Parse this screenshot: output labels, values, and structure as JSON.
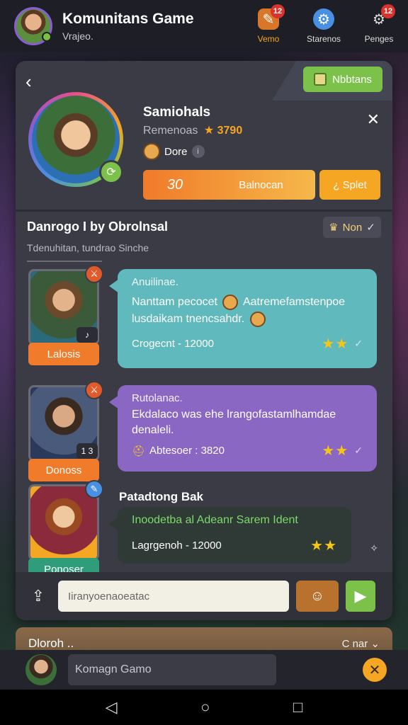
{
  "header": {
    "title": "Komunitans Game",
    "subtitle": "Vrajeo.",
    "nav": [
      {
        "label": "Vemo",
        "badge": "12",
        "icon": "feather-icon"
      },
      {
        "label": "Starenos",
        "badge": "",
        "icon": "gear-cloud-icon"
      },
      {
        "label": "Penges",
        "badge": "12",
        "icon": "settings-icon"
      }
    ]
  },
  "profile": {
    "tag_label": "Nbbtans",
    "name": "Samiohals",
    "subtitle": "Remenoas",
    "score": "★ 3790",
    "role": "Dore",
    "action_number": "30",
    "action_label": "Balnocan",
    "split_label": "¿ Splet"
  },
  "section": {
    "title": "Danrogo I by Obrolnsal",
    "subtitle": "Tdenuhitan, tundrao Sinche",
    "filter_label": "Non"
  },
  "messages": [
    {
      "author_label": "Lalosis",
      "header": "Anuilinae.",
      "text_a": "Nanttam pecocet",
      "text_b": "Aatremefamstenpoe",
      "text_c": "lusdaikam tnencsahdr.",
      "meta": "Crogecnt - 12000",
      "stars": "★★",
      "bubble_color": "#5fb9bd",
      "label_color": "#f07b2a",
      "badge_color": "#e05a2b"
    },
    {
      "author_label": "Donoss",
      "header": "Rutolanac.",
      "text": "Ekdalaco was ehe lrangofastamlhamdae denaleli.",
      "meta": "Abtesoer : 3820",
      "mini": "1 3",
      "stars": "★★",
      "bubble_color": "#8b67c4",
      "label_color": "#f07b2a",
      "badge_color": "#e05a2b"
    },
    {
      "author_label": "Ponoser",
      "header": "Patadtong Bak",
      "text": "Inoodetba al Adeanr Sarem Ident",
      "meta": "Lagrgenoh - 12000",
      "stars": "★★",
      "bubble_color": "#2f3a36",
      "label_color": "#2f9c7a",
      "badge_color": "#4a90e2"
    }
  ],
  "input": {
    "placeholder": "Iiranyoenaoeatac"
  },
  "panel2": {
    "title": "Dloroh ..",
    "right": "C nar ⌄"
  },
  "bottom": {
    "placeholder": "Komagn Gamo"
  }
}
